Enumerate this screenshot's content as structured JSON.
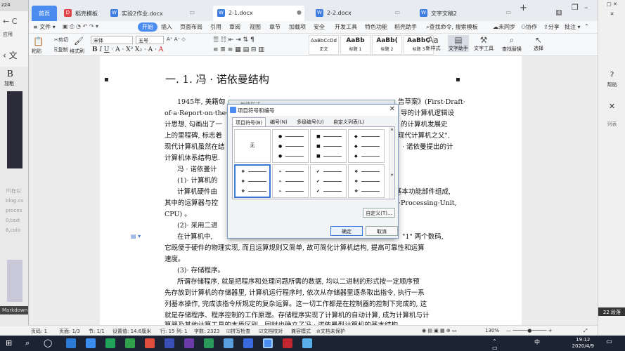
{
  "bg_window": {
    "tab_label": "z24",
    "apps_label": "应用",
    "doc_head": "文",
    "bold_glyph": "B",
    "bold_label": "加粗",
    "code_lines": [
      "!f(在以",
      "blog.cs",
      "proces",
      "0,text",
      "6,colo"
    ],
    "markdown_label": "Markdown"
  },
  "titlebar": {
    "home_tab": "首页",
    "tabs": [
      {
        "label": "稻壳模板",
        "icon_color": "#e0454a"
      },
      {
        "label": "实验2作业.docx",
        "icon_color": "#3d7de0"
      },
      {
        "label": "2-1.docx",
        "icon_color": "#3d7de0",
        "active": true
      },
      {
        "label": "2-2.docx",
        "icon_color": "#3d7de0"
      },
      {
        "label": "文字文稿2",
        "icon_color": "#3d7de0"
      }
    ],
    "add_tab": "+",
    "badge": "4"
  },
  "menubar": {
    "file": "文件",
    "start": "开始",
    "items": [
      "插入",
      "页面布局",
      "引用",
      "审阅",
      "视图",
      "章节",
      "加载项",
      "安全",
      "开发工具",
      "特色功能",
      "稻壳助手"
    ],
    "search": "查找命令, 搜索模板",
    "unsynced": "未同步",
    "collab": "协作",
    "share": "分享",
    "comment": "批注"
  },
  "ribbon": {
    "paste": "粘贴",
    "cut": "剪切",
    "copy": "复制",
    "format_painter": "格式刷",
    "font_name": "宋体",
    "font_size": "五号",
    "styles": [
      {
        "sample": "AaBbCcDd",
        "label": "正文"
      },
      {
        "sample": "AaBb",
        "label": "标题 1"
      },
      {
        "sample": "AaBb(",
        "label": "标题 2"
      },
      {
        "sample": "AaBbC",
        "label": "标题 3"
      }
    ],
    "new_style": "新样式",
    "text_assistant": "文字助手",
    "text_tools": "文字工具",
    "find_replace": "查找替换",
    "select": "选择"
  },
  "document": {
    "title": "一. 1. 冯 · 诺依曼结构",
    "lines": [
      "1945年, 美籍匈",
      "of·a·Report·on·the·El",
      "计思想, 勾画出了一",
      "上的里程碑, 标志着",
      "现代计算机虽然在结",
      "计算机体系结构思."
    ],
    "lines_right": [
      "告草案》(First·Draft·",
      "导的计算机逻辑设",
      "的计算机发展史",
      "现代计算机之父\".",
      "· 诺依曼提出的计"
    ],
    "item_a": "冯 · 诺依曼计",
    "item_1": "(1)· 计算机的",
    "line_hw": "计算机硬件由",
    "line_hw_r": "基本功能部件组成,",
    "line_ops": "其中的运算器与控",
    "line_ops_r": "·Processing·Unit,",
    "line_cpu": "CPU) 。",
    "item_2": "(2)· 采用二进",
    "line_comp": "在计算机中,",
    "line_comp_r": "\"1\" 两个数码,",
    "line_conv": "它既便于硬件的物理实现, 而且运算规则又简单, 故可简化计算机结构, 提高可靠性和运算",
    "line_speed": "速度。",
    "item_3": "(3)· 存储程序。",
    "p3": [
      "所谓存储程序, 就是把程序和处理问题所需的数据, 均以二进制的形式按一定顺序预",
      "先存放到计算机的存储器里, 计算机运行程序时, 依次从存储器里逐条取出指令, 执行一系",
      "列基本操作, 完成该指令所规定的复杂运算。这一切工作都是在控制器的控制下完成的, 这",
      "就是存储程序、程序控制的工作原理。存储程序实现了计算机的自动计算, 成为计算机与计",
      "算器及其他计算工具的本质区别。同时也确立了冯 · 诺依曼型计算机的基本结构。"
    ]
  },
  "back_dialog": {
    "title": "新建样式"
  },
  "dialog": {
    "title": "项目符号和编号",
    "tabs": [
      "项目符号(B)",
      "编号(N)",
      "多级编号(U)",
      "自定义列表(L)"
    ],
    "none_label": "无",
    "bullets": [
      "●",
      "■",
      "◆",
      "❖",
      "➢",
      "✔",
      "❖"
    ],
    "customize": "自定义(T)...",
    "ok": "确定",
    "cancel": "取消"
  },
  "right_panel": {
    "help": "帮助",
    "list": "列表",
    "lines_count": "22 段落"
  },
  "statusbar": {
    "page_num": "页码: 1",
    "page": "页面: 1/3",
    "section": "节: 1/1",
    "position": "设置值: 14.6厘米",
    "row_col": "行: 15  列: 1",
    "word_count": "字数: 2323",
    "spell": "拼写检查",
    "doc_check": "文档校对",
    "compat": "兼容模式",
    "protect": "文档未保护",
    "zoom": "130%"
  },
  "taskbar": {
    "time": "19:12",
    "date": "2020/4/9",
    "ime": "中"
  }
}
